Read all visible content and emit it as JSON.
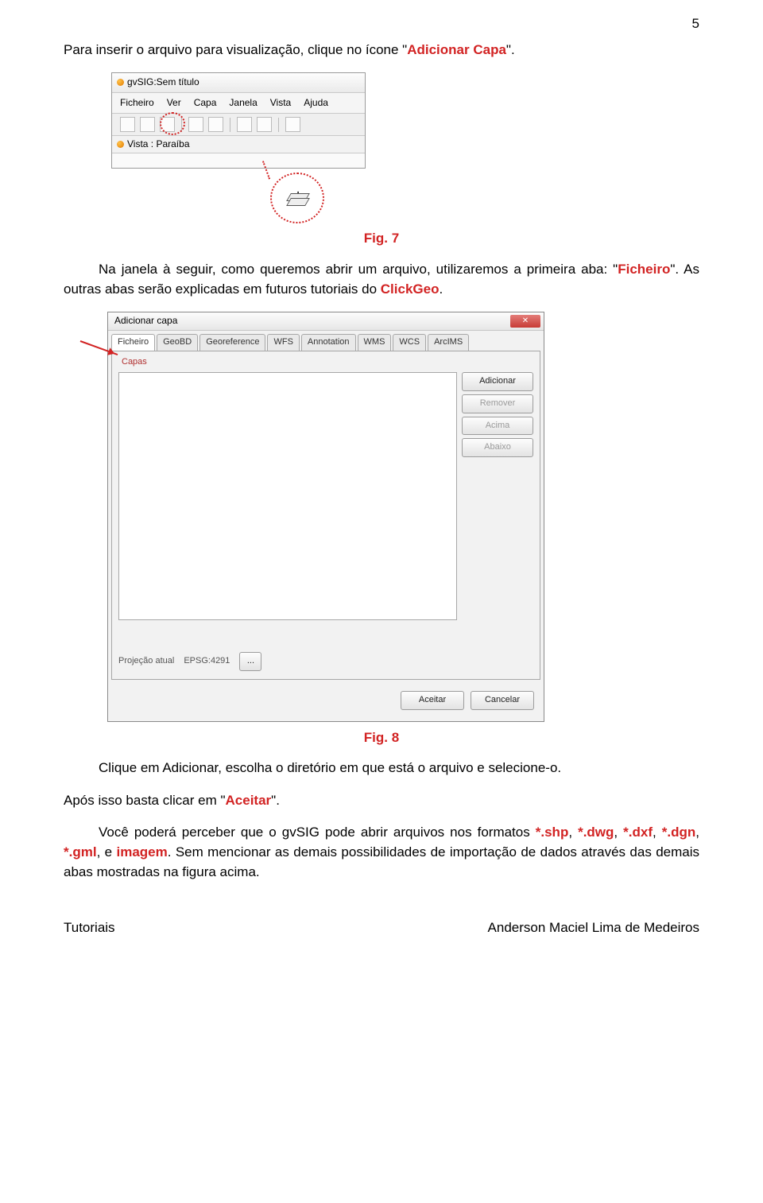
{
  "pagenum": "5",
  "para1": {
    "pre": "Para inserir o arquivo para visualização, clique no ícone \"",
    "highlight": "Adicionar Capa",
    "post": "\"."
  },
  "shot1": {
    "title": "gvSIG:Sem título",
    "menus": [
      "Ficheiro",
      "Ver",
      "Capa",
      "Janela",
      "Vista",
      "Ajuda"
    ],
    "tab_label": "Vista : Paraíba"
  },
  "caption1": "Fig. 7",
  "para2": {
    "pre_indent": "Na janela à seguir, como queremos abrir um arquivo, utilizaremos a primeira aba: \"",
    "highlight": "Ficheiro",
    "mid": "\". As outras abas serão explicadas em futuros tutoriais do ",
    "highlight2": "ClickGeo",
    "post": "."
  },
  "dialog": {
    "title": "Adicionar capa",
    "tabs": [
      "Ficheiro",
      "GeoBD",
      "Georeference",
      "WFS",
      "Annotation",
      "WMS",
      "WCS",
      "ArcIMS"
    ],
    "capas": "Capas",
    "side": [
      "Adicionar",
      "Remover",
      "Acima",
      "Abaixo"
    ],
    "proj_label": "Projeção atual",
    "proj_value": "EPSG:4291",
    "browse": "...",
    "accept": "Aceitar",
    "cancel": "Cancelar"
  },
  "caption2": "Fig. 8",
  "para3a": "Clique em Adicionar, escolha o diretório em que está o arquivo e selecione-o.",
  "para3b": {
    "pre": "Após isso basta clicar em \"",
    "highlight": "Aceitar",
    "post": "\"."
  },
  "para3c": {
    "pre": "Você poderá perceber que o gvSIG pode abrir arquivos nos formatos ",
    "ext1": "*.shp",
    "sep1": ", ",
    "ext2": "*.dwg",
    "sep2": ", ",
    "ext3": "*.dxf",
    "sep3": ", ",
    "ext4": "*.dgn",
    "sep4": ", ",
    "ext5": "*.gml",
    "sep5": ", e ",
    "ext6": "imagem",
    "post": ". Sem mencionar as demais possibilidades de importação de dados através das demais abas mostradas na figura acima."
  },
  "footer": {
    "left": "Tutoriais",
    "right": "Anderson Maciel Lima de Medeiros"
  }
}
